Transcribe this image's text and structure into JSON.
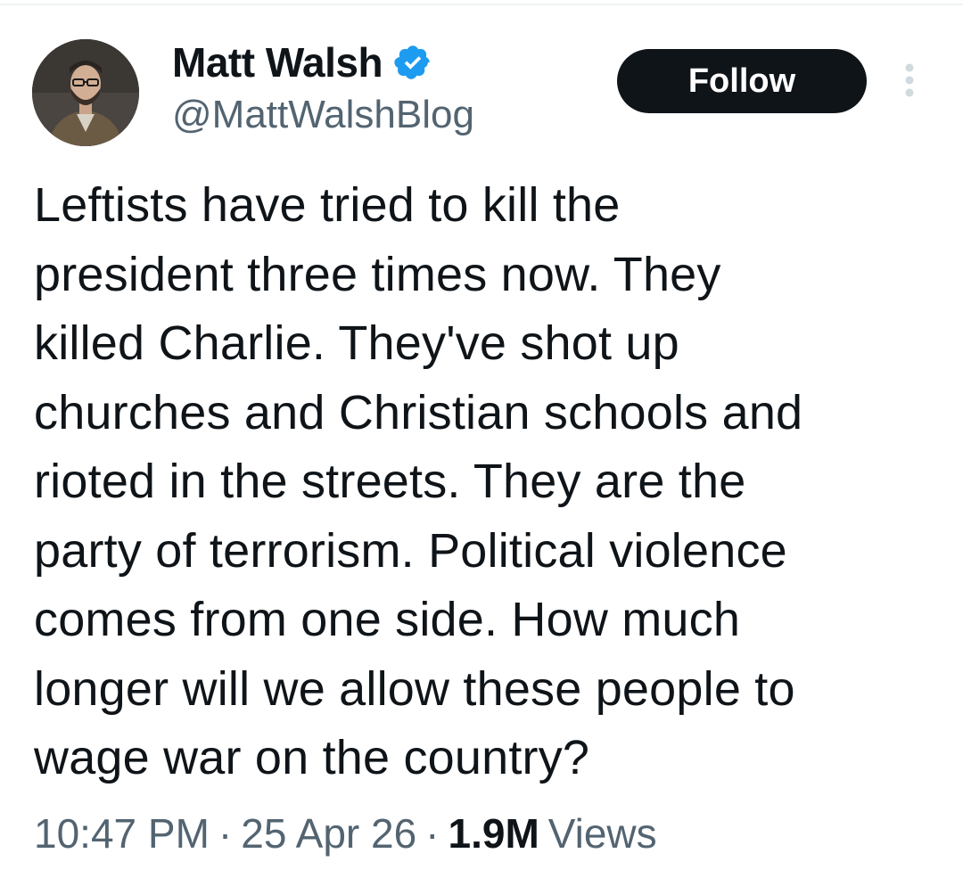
{
  "author": {
    "display_name": "Matt Walsh",
    "handle": "@MattWalshBlog",
    "avatar_icon": "profile-photo-avatar",
    "verified_icon": "verified-badge-icon",
    "verified_color": "#1d9bf0"
  },
  "actions": {
    "follow_label": "Follow",
    "more_icon": "more-options-icon"
  },
  "tweet": {
    "lines": [
      "Leftists have tried to kill the",
      "president three times now. They",
      "killed Charlie. They've shot up",
      "churches and Christian schools and",
      "rioted in the streets. They are the",
      "party of terrorism. Political violence",
      "comes from one side. How much",
      "longer will we allow these people to",
      "wage war on the country?"
    ]
  },
  "meta": {
    "time": "10:47 PM",
    "separator": "·",
    "date": "25 Apr 26",
    "views_count": "1.9M",
    "views_label": "Views"
  },
  "colors": {
    "text_primary": "#0f1419",
    "text_secondary": "#536471",
    "follow_bg": "#0f1419",
    "follow_text": "#ffffff"
  }
}
